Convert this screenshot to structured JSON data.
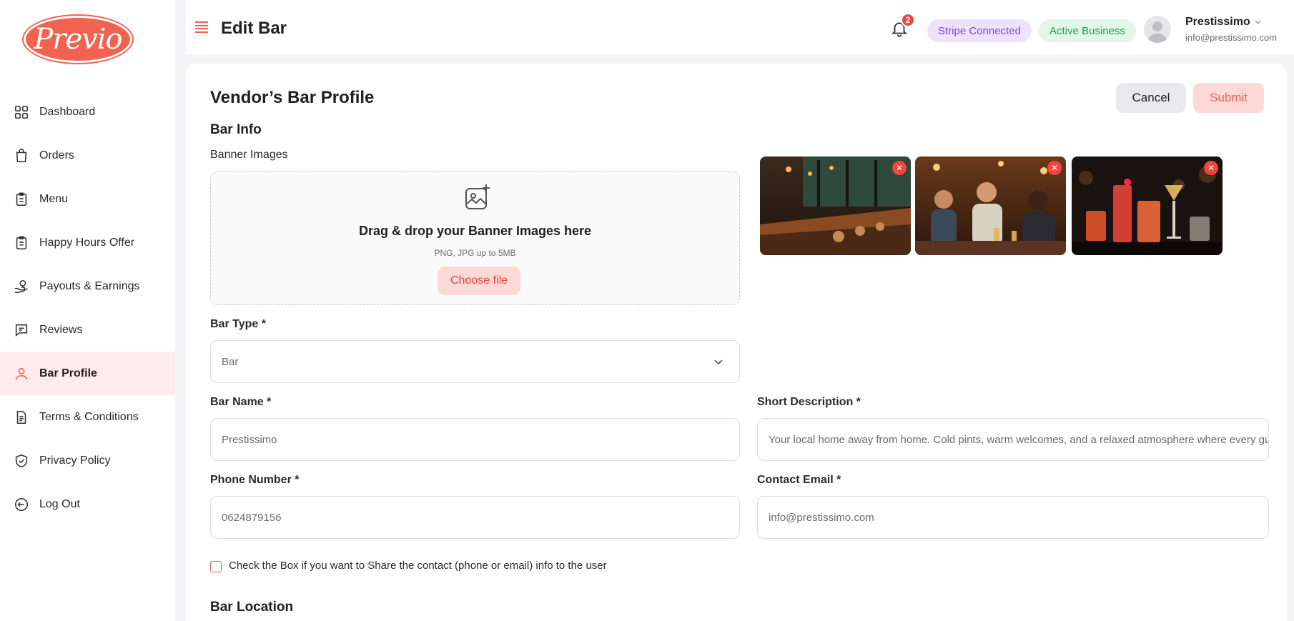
{
  "app": {
    "logo_text": "Previo",
    "brand_color": "#f26250"
  },
  "sidebar": {
    "items": [
      {
        "label": "Dashboard",
        "icon": "grid-icon",
        "active": false
      },
      {
        "label": "Orders",
        "icon": "shopping-bag-icon",
        "active": false
      },
      {
        "label": "Menu",
        "icon": "clipboard-icon",
        "active": false
      },
      {
        "label": "Happy Hours Offer",
        "icon": "clipboard-icon",
        "active": false
      },
      {
        "label": "Payouts & Earnings",
        "icon": "money-hand-icon",
        "active": false
      },
      {
        "label": "Reviews",
        "icon": "chat-review-icon",
        "active": false
      },
      {
        "label": "Bar Profile",
        "icon": "user-icon",
        "active": true
      },
      {
        "label": "Terms & Conditions",
        "icon": "document-icon",
        "active": false
      },
      {
        "label": "Privacy Policy",
        "icon": "shield-check-icon",
        "active": false
      },
      {
        "label": "Log Out",
        "icon": "logout-icon",
        "active": false
      }
    ]
  },
  "header": {
    "title": "Edit Bar",
    "notifications_count": "2",
    "stripe_badge": "Stripe Connected",
    "business_badge": "Active Business",
    "user_name": "Prestissimo",
    "user_email": "info@prestissimo.com"
  },
  "form": {
    "title": "Vendor’s Bar Profile",
    "cancel_label": "Cancel",
    "submit_label": "Submit",
    "section_bar_info": "Bar Info",
    "banner_label": "Banner Images",
    "dropzone_title": "Drag & drop your Banner Images here",
    "dropzone_hint": "PNG, JPG up to 5MB",
    "choose_file_label": "Choose file",
    "remove_label": "✕",
    "bar_type_label": "Bar Type *",
    "bar_type_value": "Bar",
    "bar_name_label": "Bar Name *",
    "bar_name_value": "Prestissimo",
    "short_desc_label": "Short Description *",
    "short_desc_value": "Your local home away from home. Cold pints, warm welcomes, and a relaxed atmosphere where every guest feels",
    "phone_label": "Phone Number *",
    "phone_value": "0624879156",
    "email_label": "Contact Email *",
    "email_value": "info@prestissimo.com",
    "share_checkbox_label": "Check the Box if you want to Share the contact (phone or email) info to the user",
    "section_location": "Bar Location"
  },
  "colors": {
    "stripe_bg": "#ede2fb",
    "stripe_text": "#8a3fe0",
    "active_bg": "#e2f7e8",
    "active_text": "#249a4a",
    "danger": "#f2453d"
  }
}
